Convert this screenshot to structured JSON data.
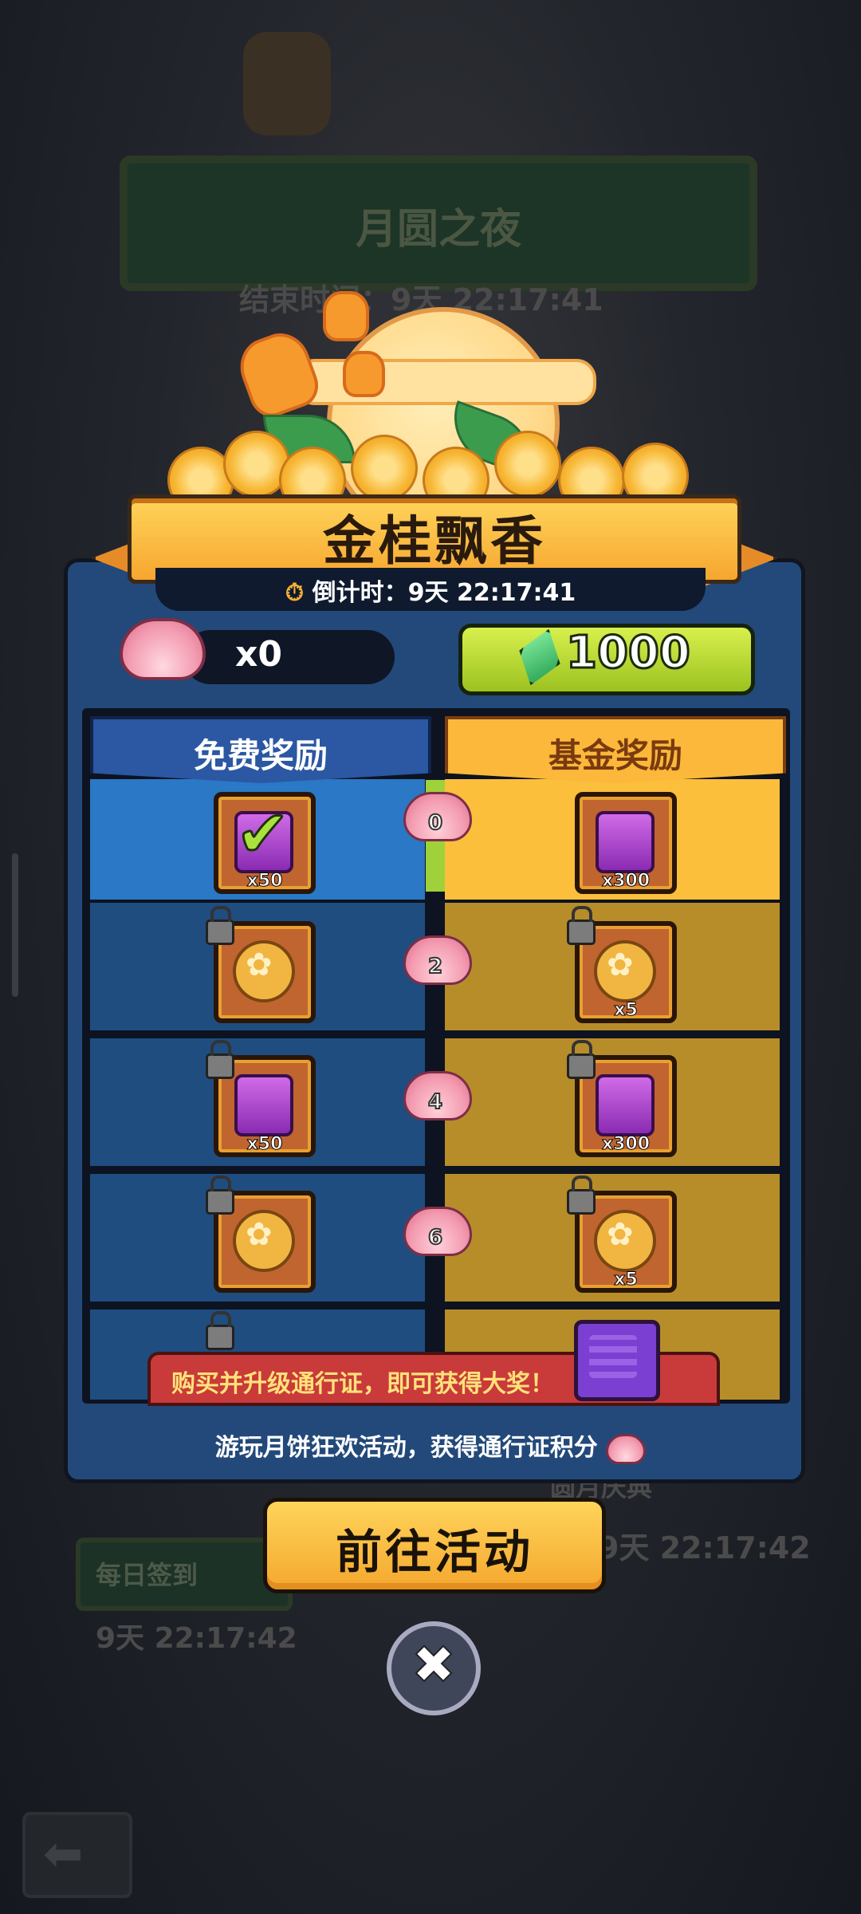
{
  "background": {
    "title": "月圆之夜",
    "end_time_label": "结束时间：9天 22:17:41",
    "right_timer": "9天 22:17:42",
    "daily_signin": "每日签到",
    "left_timer": "9天 22:17:42",
    "right_label": "圆月庆典"
  },
  "modal": {
    "title": "金桂飘香",
    "countdown": "倒计时：9天 22:17:41",
    "lotus_count": "x0",
    "gem_price": "1000",
    "tabs": {
      "free": "免费奖励",
      "paid": "基金奖励"
    },
    "rows": [
      {
        "level": "0",
        "free_qty": "x50",
        "free_item": "purple-gem",
        "free_claimed": true,
        "paid_qty": "x300",
        "paid_item": "purple-gem",
        "active": true
      },
      {
        "level": "2",
        "free_qty": "",
        "free_item": "gold-coin",
        "free_claimed": false,
        "paid_qty": "x5",
        "paid_item": "gold-coin",
        "active": false
      },
      {
        "level": "4",
        "free_qty": "x50",
        "free_item": "purple-gem",
        "free_claimed": false,
        "paid_qty": "x300",
        "paid_item": "purple-gem",
        "active": false
      },
      {
        "level": "6",
        "free_qty": "",
        "free_item": "gold-coin",
        "free_claimed": false,
        "paid_qty": "x5",
        "paid_item": "gold-coin",
        "active": false
      }
    ],
    "promo": "购买并升级通行证，即可获得大奖！",
    "footer": "游玩月饼狂欢活动，获得通行证积分",
    "go_button": "前往活动"
  },
  "colors": {
    "banner": "#fbb83a",
    "free_column": "#1f4d80",
    "paid_column": "#b78d2a",
    "gem_button": "#b7d92d",
    "promo": "#c93a3a"
  }
}
